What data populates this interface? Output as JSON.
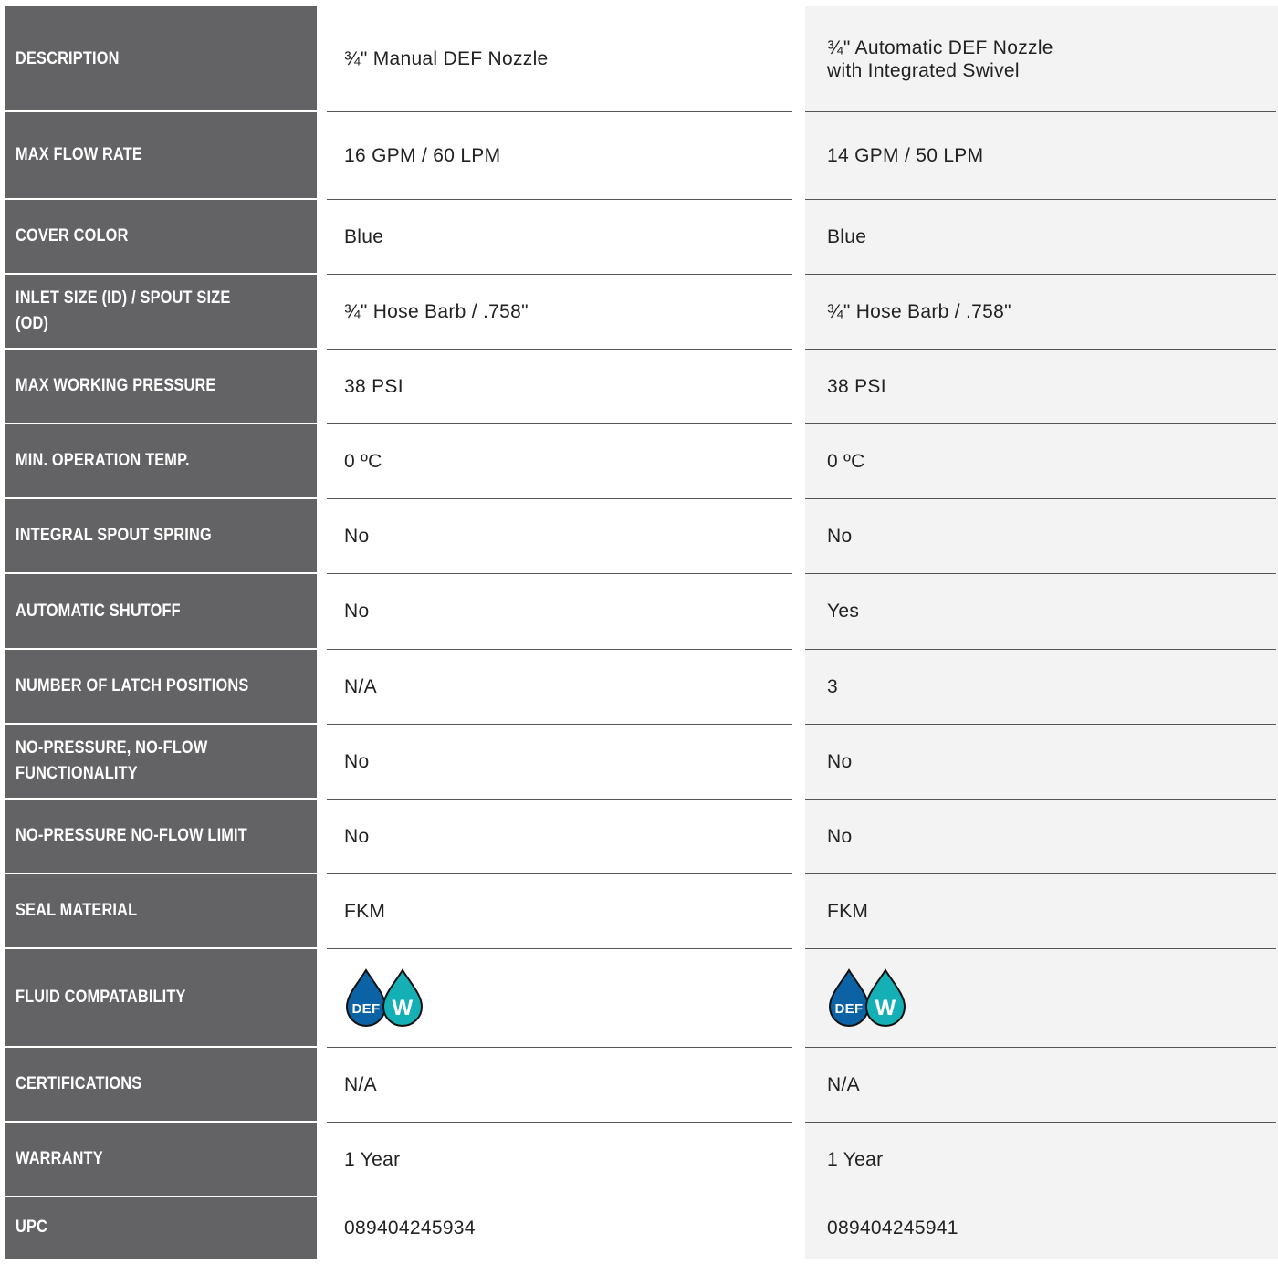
{
  "table": {
    "rows": [
      {
        "label": "DESCRIPTION",
        "col1": "¾\" Manual DEF Nozzle",
        "col2": "¾\" Automatic DEF Nozzle\nwith Integrated Swivel"
      },
      {
        "label": "MAX FLOW RATE",
        "col1": "16 GPM / 60 LPM",
        "col2": "14 GPM / 50 LPM"
      },
      {
        "label": "COVER COLOR",
        "col1": "Blue",
        "col2": "Blue"
      },
      {
        "label": "INLET SIZE (ID) / SPOUT SIZE (OD)",
        "col1": "¾\" Hose Barb / .758\"",
        "col2": "¾\" Hose Barb / .758\""
      },
      {
        "label": "MAX WORKING PRESSURE",
        "col1": "38 PSI",
        "col2": "38 PSI"
      },
      {
        "label": "MIN. OPERATION TEMP.",
        "col1": "0 ºC",
        "col2": "0 ºC"
      },
      {
        "label": "INTEGRAL SPOUT SPRING",
        "col1": "No",
        "col2": "No"
      },
      {
        "label": "AUTOMATIC SHUTOFF",
        "col1": "No",
        "col2": "Yes"
      },
      {
        "label": "NUMBER OF LATCH POSITIONS",
        "col1": "N/A",
        "col2": "3"
      },
      {
        "label": "NO-PRESSURE, NO-FLOW\nFUNCTIONALITY",
        "col1": "No",
        "col2": "No"
      },
      {
        "label": "NO-PRESSURE NO-FLOW LIMIT",
        "col1": "No",
        "col2": "No"
      },
      {
        "label": "SEAL MATERIAL",
        "col1": "FKM",
        "col2": "FKM"
      },
      {
        "label": "FLUID COMPATABILITY",
        "fluid_icons": [
          "DEF",
          "W"
        ]
      },
      {
        "label": "CERTIFICATIONS",
        "col1": "N/A",
        "col2": "N/A"
      },
      {
        "label": "WARRANTY",
        "col1": "1 Year",
        "col2": "1 Year"
      },
      {
        "label": "UPC",
        "col1": "089404245934",
        "col2": "089404245941"
      }
    ]
  },
  "icons": {
    "def_drop": {
      "name": "def-drop-icon",
      "color": "#0b63a6",
      "text": "DEF"
    },
    "water_drop": {
      "name": "water-drop-icon",
      "color": "#15b0b5",
      "text": "W"
    }
  },
  "colors": {
    "label_column": "#636366",
    "label_text": "#ffffff",
    "col3_background": "#f3f3f3",
    "value_text": "#222222"
  }
}
